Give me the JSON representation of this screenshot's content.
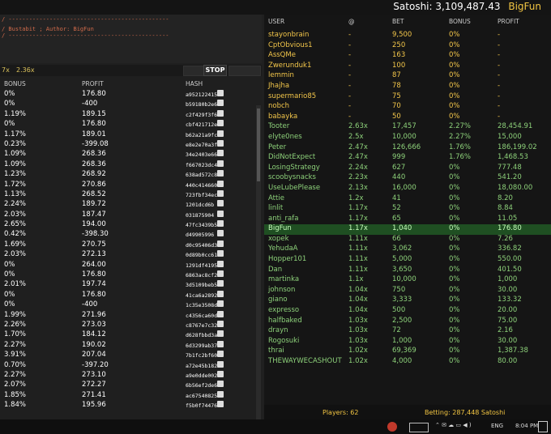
{
  "topbar": {
    "satoshi_label": "Satoshi: 3,109,487.43",
    "username": "BigFun"
  },
  "script": {
    "line1": "/ -----------------------------------------------",
    "line2": "/ Bustabit ; Author: BigFun",
    "line3": "/ -----------------------------------------------"
  },
  "controls": {
    "multiplier_a": "7x",
    "multiplier_b": "2.36x",
    "stop_label": "STOP"
  },
  "history": {
    "headers": {
      "bonus": "BONUS",
      "profit": "PROFIT",
      "hash": "HASH"
    },
    "rows": [
      {
        "bonus": "0%",
        "profit": "176.80",
        "hash": "a952122415"
      },
      {
        "bonus": "0%",
        "profit": "-400",
        "hash": "b59180b2e6"
      },
      {
        "bonus": "1.19%",
        "profit": "189.15",
        "hash": "c2f429f3f63"
      },
      {
        "bonus": "0%",
        "profit": "176.80",
        "hash": "cbf421712ef"
      },
      {
        "bonus": "1.17%",
        "profit": "189.01",
        "hash": "b62a21a9fc"
      },
      {
        "bonus": "0.23%",
        "profit": "-399.08",
        "hash": "e8e2e70a3f"
      },
      {
        "bonus": "1.09%",
        "profit": "268.36",
        "hash": "34e2403e66"
      },
      {
        "bonus": "1.09%",
        "profit": "268.36",
        "hash": "f667023dc4"
      },
      {
        "bonus": "1.23%",
        "profit": "268.92",
        "hash": "638ad572c8"
      },
      {
        "bonus": "1.72%",
        "profit": "270.86",
        "hash": "440c414660"
      },
      {
        "bonus": "1.13%",
        "profit": "268.52",
        "hash": "723fbf34ecc"
      },
      {
        "bonus": "2.24%",
        "profit": "189.72",
        "hash": "1201dcd6b"
      },
      {
        "bonus": "2.03%",
        "profit": "187.47",
        "hash": "031875904"
      },
      {
        "bonus": "2.65%",
        "profit": "194.00",
        "hash": "47fc3439b5"
      },
      {
        "bonus": "0.42%",
        "profit": "-398.30",
        "hash": "d49905996"
      },
      {
        "bonus": "1.69%",
        "profit": "270.75",
        "hash": "d0c95406d3"
      },
      {
        "bonus": "2.03%",
        "profit": "272.13",
        "hash": "0d89b0cc61"
      },
      {
        "bonus": "0%",
        "profit": "264.00",
        "hash": "1291df4195"
      },
      {
        "bonus": "0%",
        "profit": "176.80",
        "hash": "6863ac8cf2"
      },
      {
        "bonus": "2.01%",
        "profit": "197.74",
        "hash": "3d5109beb5"
      },
      {
        "bonus": "0%",
        "profit": "176.80",
        "hash": "41ca6a2892"
      },
      {
        "bonus": "0%",
        "profit": "-400",
        "hash": "1c35e3508d"
      },
      {
        "bonus": "1.99%",
        "profit": "271.96",
        "hash": "c4356ca60d"
      },
      {
        "bonus": "2.26%",
        "profit": "273.03",
        "hash": "c8767e7c32"
      },
      {
        "bonus": "1.70%",
        "profit": "184.12",
        "hash": "d628fbbd3a"
      },
      {
        "bonus": "2.27%",
        "profit": "190.02",
        "hash": "6d3299ab37"
      },
      {
        "bonus": "3.91%",
        "profit": "207.04",
        "hash": "7b1fc2bf600"
      },
      {
        "bonus": "0.70%",
        "profit": "-397.20",
        "hash": "a72e45b182"
      },
      {
        "bonus": "2.27%",
        "profit": "273.10",
        "hash": "a9e0dde002"
      },
      {
        "bonus": "2.07%",
        "profit": "272.27",
        "hash": "6b56ef2de6"
      },
      {
        "bonus": "1.85%",
        "profit": "271.41",
        "hash": "ac67540825"
      },
      {
        "bonus": "1.84%",
        "profit": "195.96",
        "hash": "f5b0f74476"
      }
    ]
  },
  "players": {
    "headers": {
      "user": "USER",
      "at": "@",
      "bet": "BET",
      "bonus": "BONUS",
      "profit": "PROFIT"
    },
    "rows": [
      {
        "user": "stayonbrain",
        "at": "-",
        "bet": "9,500",
        "bonus": "0%",
        "profit": "-",
        "state": "pending"
      },
      {
        "user": "CptObvious1",
        "at": "-",
        "bet": "250",
        "bonus": "0%",
        "profit": "-",
        "state": "pending"
      },
      {
        "user": "AssQMe",
        "at": "-",
        "bet": "163",
        "bonus": "0%",
        "profit": "-",
        "state": "pending"
      },
      {
        "user": "Zwerunduk1",
        "at": "-",
        "bet": "100",
        "bonus": "0%",
        "profit": "-",
        "state": "pending"
      },
      {
        "user": "lemmin",
        "at": "-",
        "bet": "87",
        "bonus": "0%",
        "profit": "-",
        "state": "pending"
      },
      {
        "user": "Jhajha",
        "at": "-",
        "bet": "78",
        "bonus": "0%",
        "profit": "-",
        "state": "pending"
      },
      {
        "user": "supermario85",
        "at": "-",
        "bet": "75",
        "bonus": "0%",
        "profit": "-",
        "state": "pending"
      },
      {
        "user": "nobch",
        "at": "-",
        "bet": "70",
        "bonus": "0%",
        "profit": "-",
        "state": "pending"
      },
      {
        "user": "babayka",
        "at": "-",
        "bet": "50",
        "bonus": "0%",
        "profit": "-",
        "state": "pending"
      },
      {
        "user": "Tooter",
        "at": "2.63x",
        "bet": "17,457",
        "bonus": "2.27%",
        "profit": "28,454.91",
        "state": "done"
      },
      {
        "user": "elyte0nes",
        "at": "2.5x",
        "bet": "10,000",
        "bonus": "2.27%",
        "profit": "15,000",
        "state": "done"
      },
      {
        "user": "Peter",
        "at": "2.47x",
        "bet": "126,666",
        "bonus": "1.76%",
        "profit": "186,199.02",
        "state": "done"
      },
      {
        "user": "DidNotExpect",
        "at": "2.47x",
        "bet": "999",
        "bonus": "1.76%",
        "profit": "1,468.53",
        "state": "done"
      },
      {
        "user": "LosingStrategy",
        "at": "2.24x",
        "bet": "627",
        "bonus": "0%",
        "profit": "777.48",
        "state": "done"
      },
      {
        "user": "scoobysnacks",
        "at": "2.23x",
        "bet": "440",
        "bonus": "0%",
        "profit": "541.20",
        "state": "done"
      },
      {
        "user": "UseLubePlease",
        "at": "2.13x",
        "bet": "16,000",
        "bonus": "0%",
        "profit": "18,080.00",
        "state": "done"
      },
      {
        "user": "Attie",
        "at": "1.2x",
        "bet": "41",
        "bonus": "0%",
        "profit": "8.20",
        "state": "done"
      },
      {
        "user": "linlit",
        "at": "1.17x",
        "bet": "52",
        "bonus": "0%",
        "profit": "8.84",
        "state": "done"
      },
      {
        "user": "anti_rafa",
        "at": "1.17x",
        "bet": "65",
        "bonus": "0%",
        "profit": "11.05",
        "state": "done"
      },
      {
        "user": "BigFun",
        "at": "1.17x",
        "bet": "1,040",
        "bonus": "0%",
        "profit": "176.80",
        "state": "me"
      },
      {
        "user": "xopek",
        "at": "1.11x",
        "bet": "66",
        "bonus": "0%",
        "profit": "7.26",
        "state": "done"
      },
      {
        "user": "YehudaA",
        "at": "1.11x",
        "bet": "3,062",
        "bonus": "0%",
        "profit": "336.82",
        "state": "done"
      },
      {
        "user": "Hopper101",
        "at": "1.11x",
        "bet": "5,000",
        "bonus": "0%",
        "profit": "550.00",
        "state": "done"
      },
      {
        "user": "Dan",
        "at": "1.11x",
        "bet": "3,650",
        "bonus": "0%",
        "profit": "401.50",
        "state": "done"
      },
      {
        "user": "martinka",
        "at": "1.1x",
        "bet": "10,000",
        "bonus": "0%",
        "profit": "1,000",
        "state": "done"
      },
      {
        "user": "johnson",
        "at": "1.04x",
        "bet": "750",
        "bonus": "0%",
        "profit": "30.00",
        "state": "done"
      },
      {
        "user": "giano",
        "at": "1.04x",
        "bet": "3,333",
        "bonus": "0%",
        "profit": "133.32",
        "state": "done"
      },
      {
        "user": "expresso",
        "at": "1.04x",
        "bet": "500",
        "bonus": "0%",
        "profit": "20.00",
        "state": "done"
      },
      {
        "user": "halfbaked",
        "at": "1.03x",
        "bet": "2,500",
        "bonus": "0%",
        "profit": "75.00",
        "state": "done"
      },
      {
        "user": "drayn",
        "at": "1.03x",
        "bet": "72",
        "bonus": "0%",
        "profit": "2.16",
        "state": "done"
      },
      {
        "user": "Rogosuki",
        "at": "1.03x",
        "bet": "1,000",
        "bonus": "0%",
        "profit": "30.00",
        "state": "done"
      },
      {
        "user": "thrai",
        "at": "1.02x",
        "bet": "69,369",
        "bonus": "0%",
        "profit": "1,387.38",
        "state": "done"
      },
      {
        "user": "THEWAYWECASHOUT",
        "at": "1.02x",
        "bet": "4,000",
        "bonus": "0%",
        "profit": "80.00",
        "state": "done"
      }
    ],
    "footer": {
      "players": "Players: 62",
      "betting": "Betting: 287,448 Satoshi"
    }
  },
  "taskbar": {
    "lang": "ENG",
    "time": "8:04 PM"
  }
}
